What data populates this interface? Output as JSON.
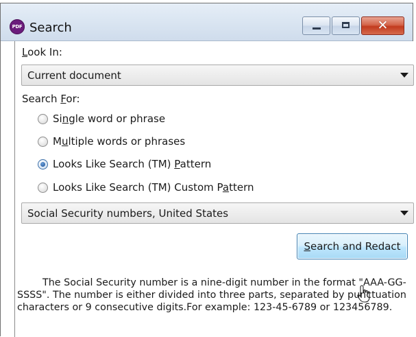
{
  "window": {
    "title": "Search",
    "app_icon_text": "PDF"
  },
  "look_in": {
    "label_prefix": "",
    "label_underline": "L",
    "label_suffix": "ook In:",
    "selected": "Current document"
  },
  "search_for": {
    "label_prefix": "Search ",
    "label_underline": "F",
    "label_suffix": "or:",
    "options": [
      {
        "pre": "Si",
        "u": "n",
        "post": "gle word or phrase",
        "checked": false
      },
      {
        "pre": "M",
        "u": "u",
        "post": "ltiple words or phrases",
        "checked": false
      },
      {
        "pre": "Looks Like Search (TM) ",
        "u": "P",
        "post": "attern",
        "checked": true
      },
      {
        "pre": "Looks Like Search (TM) Custom P",
        "u": "a",
        "post": "ttern",
        "checked": false
      }
    ]
  },
  "pattern": {
    "selected": "Social Security numbers, United States"
  },
  "action": {
    "button_underline": "S",
    "button_rest": "earch and Redact"
  },
  "description": "The Social Security number is a nine-digit number in the format \"AAA-GG-SSSS\". The number is either divided into three parts, separated by punctuation characters or 9 consecutive digits.For example: 123-45-6789 or 123456789.",
  "colors": {
    "button_fill": "#bee6fd",
    "close_button": "#c23b1f",
    "app_icon": "#6b1c7c",
    "radio_checked": "#1d4f91"
  }
}
